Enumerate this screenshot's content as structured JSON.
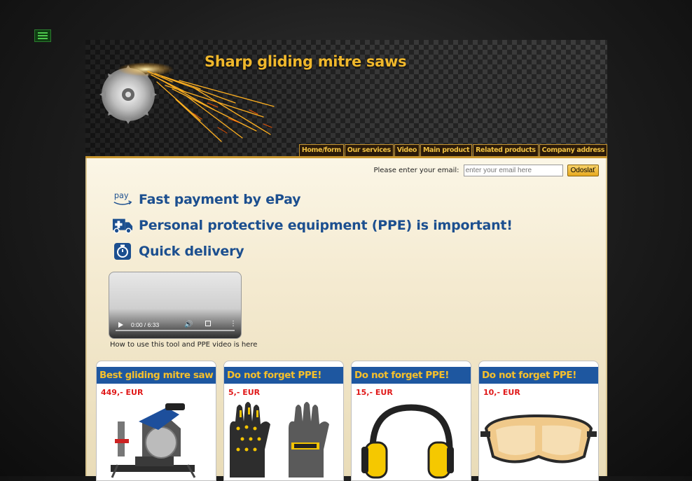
{
  "header": {
    "title": "Sharp gliding mitre saws",
    "nav": [
      "Home/form",
      "Our services",
      "Video",
      "Main product",
      "Related products",
      "Company address"
    ]
  },
  "email": {
    "label": "Please enter your email:",
    "placeholder": "enter your email here",
    "submit": "Odoslať"
  },
  "features": [
    {
      "icon": "pay-icon",
      "icon_text": "pay",
      "text": "Fast payment by ePay"
    },
    {
      "icon": "ambulance-icon",
      "text": "Personal protective equipment (PPE) is important!"
    },
    {
      "icon": "stopwatch-icon",
      "text": "Quick delivery"
    }
  ],
  "video": {
    "time": "0:00 / 6:33",
    "caption": "How to use this tool and PPE video is here"
  },
  "products": [
    {
      "title": "Best gliding mitre saw",
      "price": "449,- EUR",
      "image": "mitre-saw"
    },
    {
      "title": "Do not forget PPE!",
      "price": "5,- EUR",
      "image": "work-gloves"
    },
    {
      "title": "Do not forget PPE!",
      "price": "15,- EUR",
      "image": "ear-muffs"
    },
    {
      "title": "Do not forget PPE!",
      "price": "10,- EUR",
      "image": "safety-goggles"
    }
  ],
  "colors": {
    "accent": "#f0b82c",
    "nav_border": "#c7952e",
    "feature_text": "#1c4f8f",
    "card_header": "#1e57a0",
    "price": "#e01818"
  }
}
